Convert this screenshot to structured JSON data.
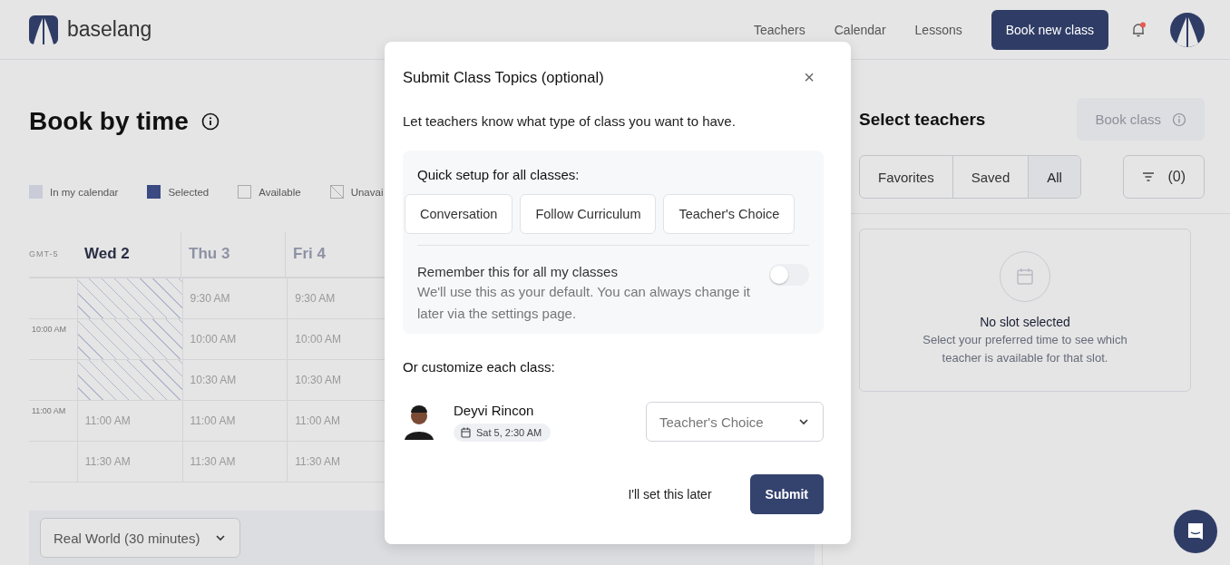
{
  "header": {
    "logo_text": "baselang",
    "nav": [
      {
        "label": "Teachers"
      },
      {
        "label": "Calendar"
      },
      {
        "label": "Lessons"
      }
    ],
    "book_button": "Book new class",
    "notification": {
      "unread": true
    }
  },
  "page": {
    "title": "Book by time",
    "legend": [
      {
        "label": "In my calendar",
        "kind": "calendar"
      },
      {
        "label": "Selected",
        "kind": "selected"
      },
      {
        "label": "Available",
        "kind": "available"
      },
      {
        "label": "Unavai",
        "kind": "unavailable"
      }
    ],
    "timezone": "GMT-5",
    "days": [
      {
        "label": "Wed 2",
        "selected": true
      },
      {
        "label": "Thu 3",
        "selected": false
      },
      {
        "label": "Fri 4",
        "selected": false
      }
    ],
    "rows": [
      {
        "cells": [
          {
            "kind": "unavailable"
          },
          {
            "kind": "available",
            "label": "9:30 AM"
          },
          {
            "kind": "available",
            "label": "9:30 AM"
          }
        ]
      },
      {
        "hour_label": "10:00 AM",
        "cells": [
          {
            "kind": "unavailable"
          },
          {
            "kind": "available",
            "label": "10:00 AM"
          },
          {
            "kind": "available",
            "label": "10:00 AM"
          }
        ]
      },
      {
        "cells": [
          {
            "kind": "unavailable"
          },
          {
            "kind": "available",
            "label": "10:30 AM"
          },
          {
            "kind": "available",
            "label": "10:30 AM"
          }
        ]
      },
      {
        "hour_label": "11:00 AM",
        "cells": [
          {
            "kind": "available",
            "label": "11:00 AM"
          },
          {
            "kind": "available",
            "label": "11:00 AM"
          },
          {
            "kind": "available",
            "label": "11:00 AM"
          }
        ]
      },
      {
        "cells": [
          {
            "kind": "available",
            "label": "11:30 AM"
          },
          {
            "kind": "available",
            "label": "11:30 AM"
          },
          {
            "kind": "available",
            "label": "11:30 AM"
          }
        ]
      }
    ],
    "duration_select": "Real World (30 minutes)"
  },
  "sidebar": {
    "title": "Select teachers",
    "book_button": {
      "label": "Book class",
      "disabled": true
    },
    "filters": [
      {
        "label": "Favorites",
        "selected": false
      },
      {
        "label": "Saved",
        "selected": false
      },
      {
        "label": "All",
        "selected": true
      }
    ],
    "filter_count": "(0)",
    "empty_title": "No slot selected",
    "empty_text": "Select your preferred time to see which teacher is available for that slot."
  },
  "modal": {
    "title": "Submit Class Topics (optional)",
    "close": "×",
    "intro": "Let teachers know what type of class you want to have.",
    "quick_setup_label": "Quick setup for all classes:",
    "options": [
      {
        "label": "Conversation"
      },
      {
        "label": "Follow Curriculum"
      },
      {
        "label": "Teacher's Choice"
      }
    ],
    "remember": {
      "label": "Remember this for all my classes",
      "description": "We'll use this as your default. You can always change it later via the settings page.",
      "on": false
    },
    "customize_label": "Or customize each class:",
    "classes": [
      {
        "teacher": "Deyvi Rincon",
        "time": "Sat 5, 2:30 AM",
        "topic": "Teacher's Choice"
      }
    ],
    "later_button": "I'll set this later",
    "submit_button": "Submit"
  }
}
